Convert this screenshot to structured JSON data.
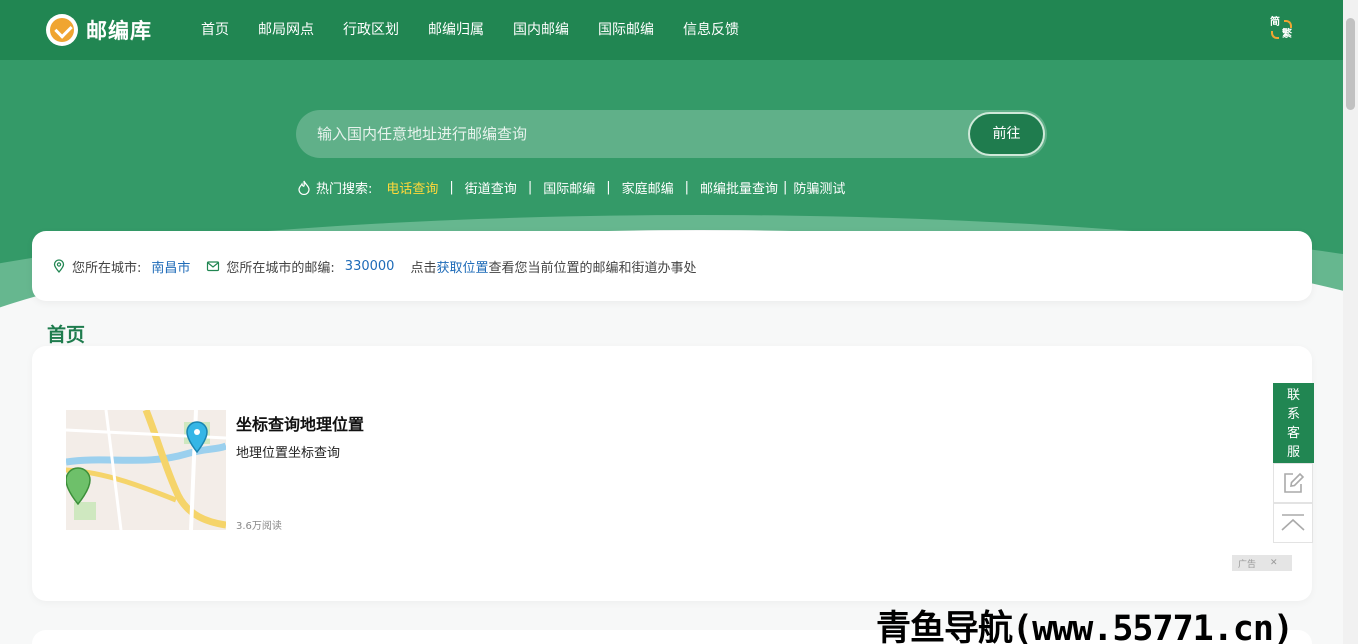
{
  "logo": {
    "name": "邮编库"
  },
  "nav": [
    "首页",
    "邮局网点",
    "行政区划",
    "邮编归属",
    "国内邮编",
    "国际邮编",
    "信息反馈"
  ],
  "lang_toggle": {
    "simplified": "简",
    "traditional": "繁"
  },
  "search": {
    "placeholder": "输入国内任意地址进行邮编查询",
    "button": "前往"
  },
  "hot_search": {
    "label": "热门搜索:",
    "items": [
      "电话查询",
      "街道查询",
      "国际邮编",
      "家庭邮编",
      "邮编批量查询",
      "防骗测试"
    ],
    "highlight_color": "#ffd83a"
  },
  "location": {
    "city_label": "您所在城市:",
    "city": "南昌市",
    "code_label": "您所在城市的邮编:",
    "code": "330000",
    "hint_prefix": "点击",
    "hint_link": "获取位置",
    "hint_suffix": "查看您当前位置的邮编和街道办事处"
  },
  "section": {
    "title": "首页"
  },
  "article": {
    "title": "坐标查询地理位置",
    "desc": "地理位置坐标查询",
    "reads": "3.6万阅读"
  },
  "ad": {
    "label": "广告",
    "close": "✕"
  },
  "float": {
    "service": "联系客服"
  },
  "watermark": "青鱼导航(www.55771.cn)",
  "colors": {
    "brand": "#218652",
    "hero": "#349a68",
    "link": "#1e6bb8"
  }
}
